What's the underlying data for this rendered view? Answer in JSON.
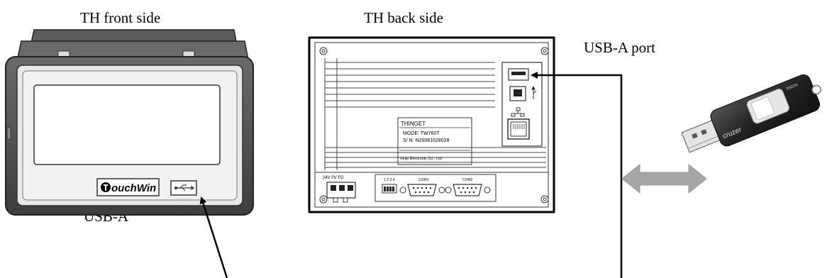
{
  "labels": {
    "front_side": "TH front side",
    "back_side": "TH back side",
    "usb_a": "USB-A",
    "usb_a_port": "USB-A port"
  },
  "front_panel": {
    "logo_text": "ouchWin"
  },
  "back_panel": {
    "plate_brand": "THINGET",
    "plate_mode": "MODE: TW760T",
    "plate_sn": "S/ N: N20081028028",
    "plate_maker": "Xinje Electronic Co., Ltd",
    "power_label": "24V 0V FG",
    "dip_label": "1 2 3 4",
    "com1_label": "COM1",
    "com2_label": "COM2"
  },
  "usb_stick": {
    "brand_text": "cruzer",
    "model_text": "micro"
  },
  "colors": {
    "arrow_fill": "#a6a6a6",
    "bezel": "#4a4a4a",
    "stick_body": "#2b2b2b"
  }
}
